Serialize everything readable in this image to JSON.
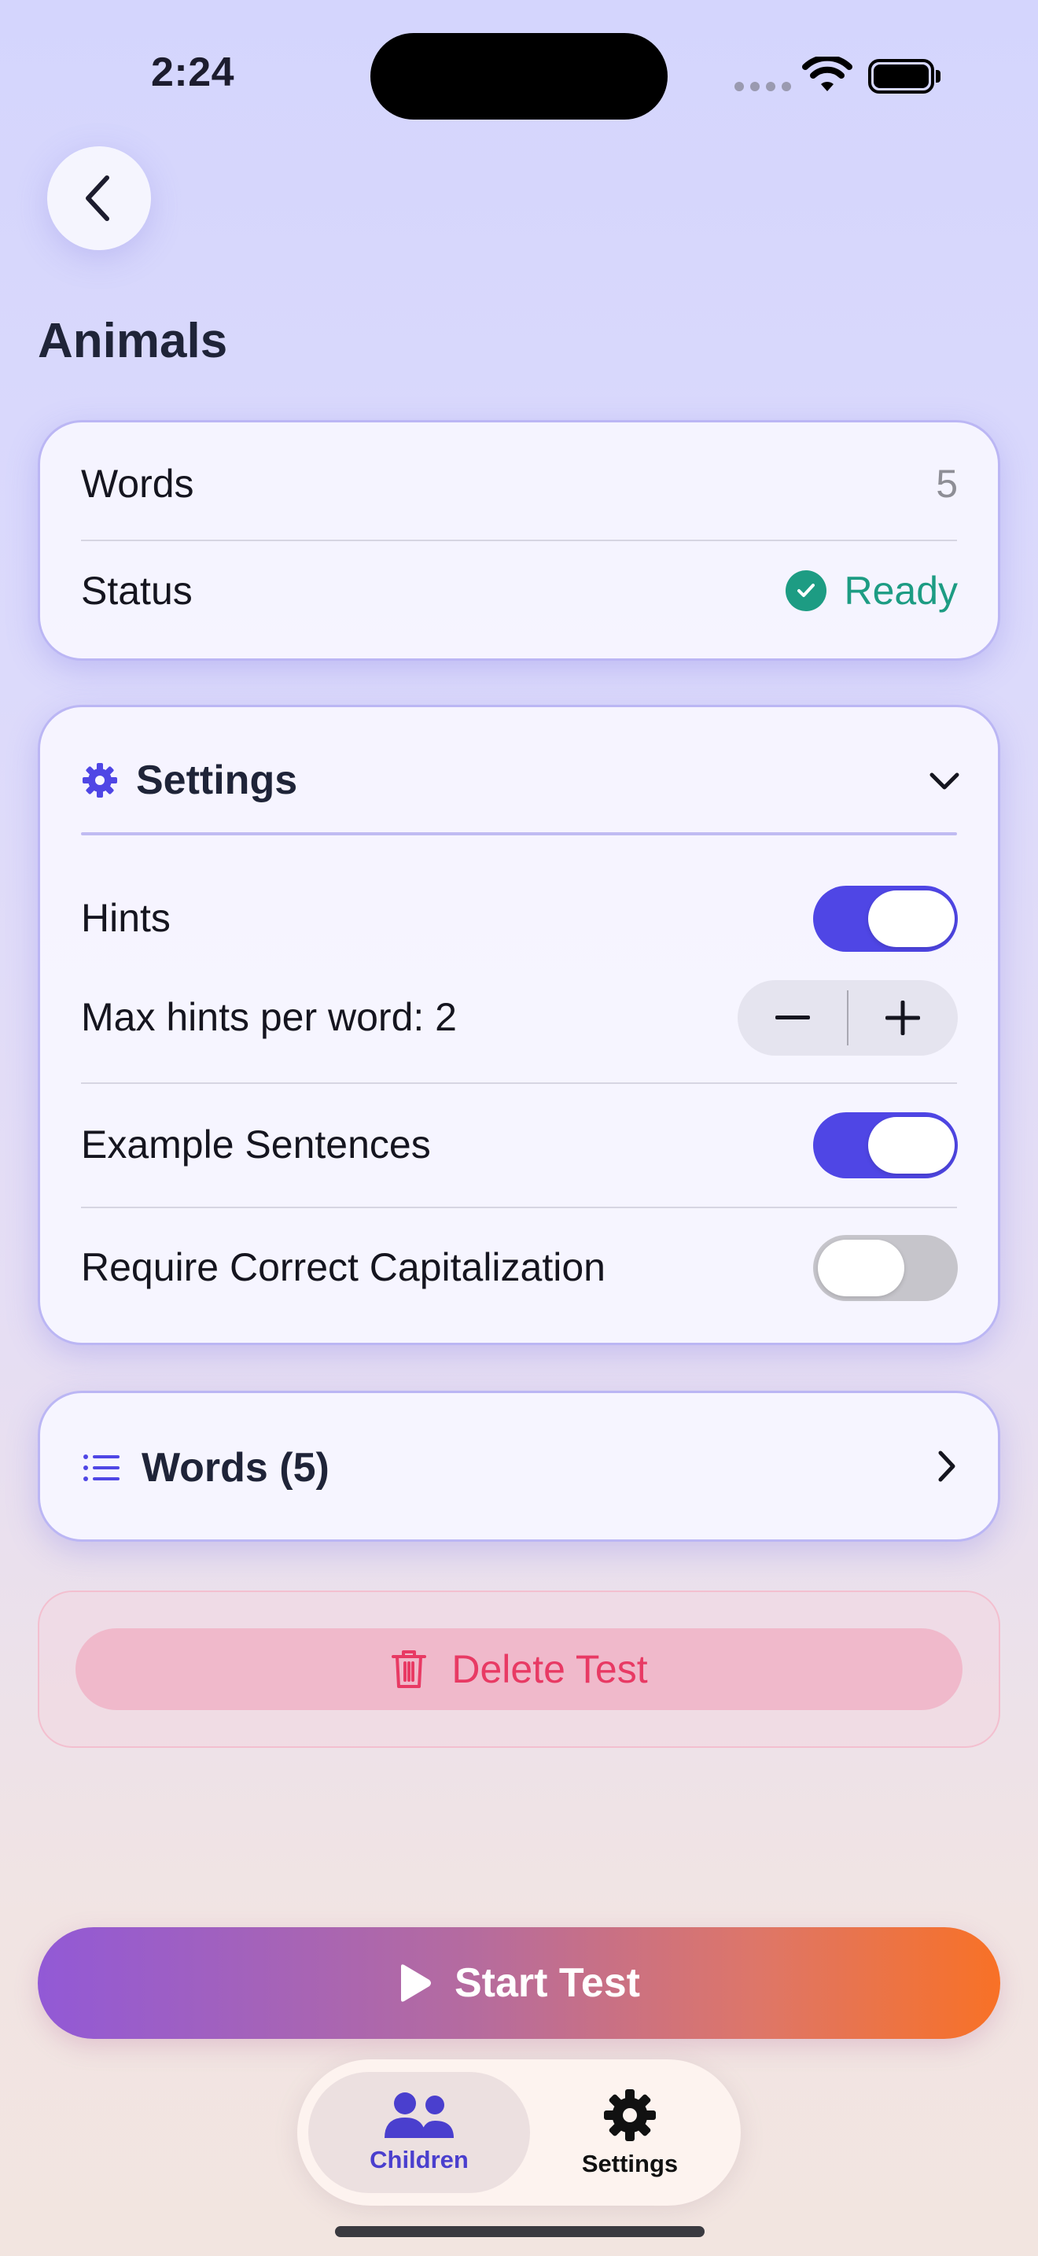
{
  "status_bar": {
    "time": "2:24"
  },
  "page": {
    "title": "Animals"
  },
  "info": {
    "words_label": "Words",
    "words_value": "5",
    "status_label": "Status",
    "status_value": "Ready"
  },
  "settings": {
    "title": "Settings",
    "expanded": true,
    "hints": {
      "label": "Hints",
      "on": true
    },
    "max_hints": {
      "label": "Max hints per word: 2",
      "value": 2
    },
    "example_sentences": {
      "label": "Example Sentences",
      "on": true
    },
    "capitalization": {
      "label": "Require Correct Capitalization",
      "on": false
    }
  },
  "words_link": {
    "label": "Words (5)"
  },
  "delete": {
    "label": "Delete Test"
  },
  "start": {
    "label": "Start Test"
  },
  "tabbar": {
    "children_label": "Children",
    "settings_label": "Settings",
    "selected": "Children"
  },
  "colors": {
    "accent": "#4f46e5",
    "ready": "#1d9c83",
    "danger": "#e83a64",
    "start_gradient_from": "#9259d6",
    "start_gradient_to": "#f87126"
  },
  "icons": {
    "back": "chevron-left-icon",
    "status": "checkmark-circle-icon",
    "settings": "gear-icon",
    "collapse": "chevron-down-icon",
    "words": "list-icon",
    "words_nav": "chevron-right-icon",
    "delete": "trash-icon",
    "start": "play-icon",
    "tab_children": "people-icon",
    "tab_settings": "gear-icon"
  }
}
